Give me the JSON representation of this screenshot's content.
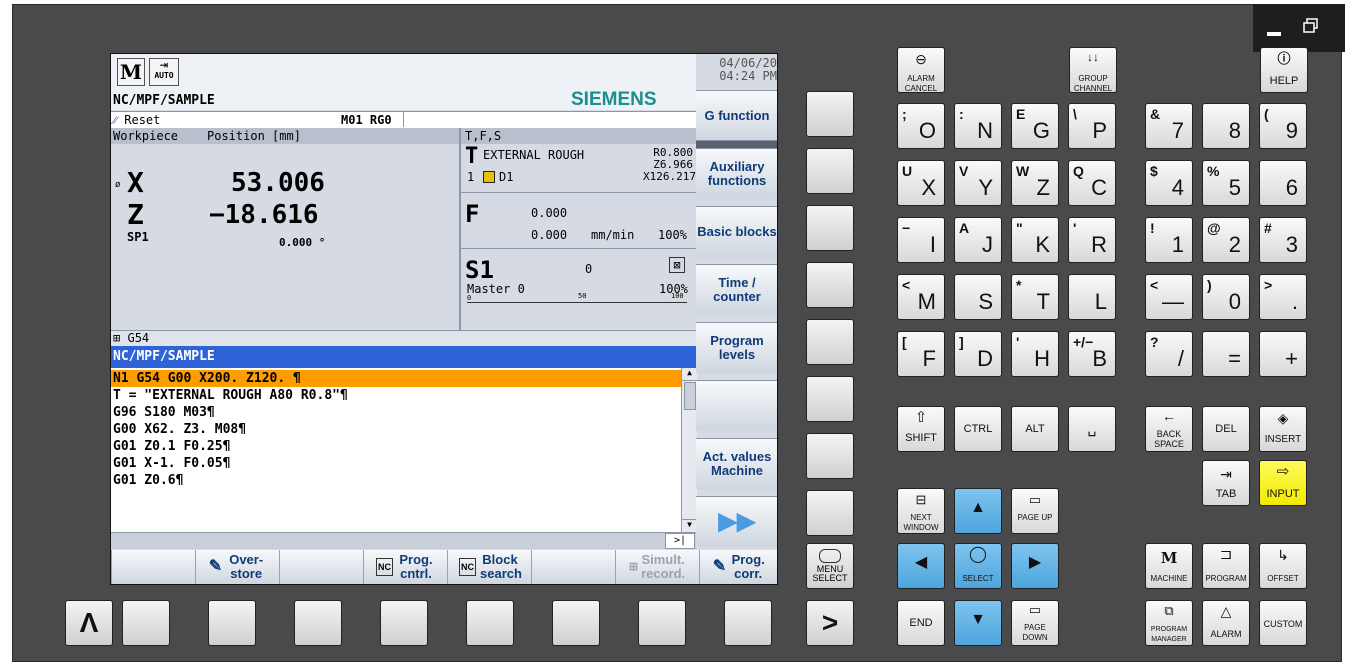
{
  "window": {
    "minimize_icon": "minimize-icon",
    "restore_icon": "restore-icon"
  },
  "screen": {
    "mode_icon_label": "M",
    "auto_label": "AUTO",
    "date": "04/06/20",
    "time": "04:24 PM",
    "program_path": "NC/MPF/SAMPLE",
    "brand": "SIEMENS",
    "status": "Reset",
    "status_right": "M01 RG0",
    "wcs_label": "Workpiece",
    "position_label": "Position [mm]",
    "tfs_label": "T,F,S",
    "axes": [
      {
        "name": "X",
        "prefix": "ø",
        "value": "53.006"
      },
      {
        "name": "Z",
        "prefix": "",
        "value": "−18.616"
      }
    ],
    "spindle": {
      "name": "SP1",
      "value": "0.000",
      "unit": "°"
    },
    "tool": {
      "letter": "T",
      "name": "EXTERNAL ROUGH",
      "radius": "R0.800",
      "z": "Z6.966",
      "x": "X126.217",
      "num": "1",
      "d": "D1"
    },
    "feed": {
      "letter": "F",
      "v1": "0.000",
      "v2": "0.000",
      "unit": "mm/min",
      "pct": "100%"
    },
    "s1": {
      "label": "S1",
      "value": "0",
      "master": "Master",
      "master_val": "0",
      "pct": "100%",
      "scale_0": "0",
      "scale_50": "50",
      "scale_100": "100"
    },
    "frame": "G54",
    "editor_path": "NC/MPF/SAMPLE",
    "code_lines": [
      "N1 G54 G00 X200. Z120. ¶",
      "T = \"EXTERNAL ROUGH A80 R0.8\"¶",
      "G96 S180 M03¶",
      "G00 X62. Z3. M08¶",
      "G01 Z0.1 F0.25¶",
      "G01 X-1. F0.05¶",
      "G01 Z0.6¶"
    ],
    "vsoftkeys": [
      "G function",
      "Auxiliary functions",
      "Basic blocks",
      "Time / counter",
      "Program levels",
      "",
      "Act. values Machine",
      ""
    ],
    "hsoftkeys": [
      {
        "label": ""
      },
      {
        "label": "Over- store"
      },
      {
        "label": ""
      },
      {
        "label": "Prog. cntrl."
      },
      {
        "label": "Block search"
      },
      {
        "label": ""
      },
      {
        "label": "Simult. record."
      },
      {
        "label": "Prog. corr."
      }
    ]
  },
  "keys": {
    "alarm_cancel": "ALARM CANCEL",
    "group_channel": "GROUP CHANNEL",
    "help": "HELP",
    "menu_select": "MENU SELECT",
    "shift": "SHIFT",
    "ctrl": "CTRL",
    "alt": "ALT",
    "backspace": "BACK SPACE",
    "del": "DEL",
    "insert": "INSERT",
    "tab": "TAB",
    "input": "INPUT",
    "next_window": "NEXT WINDOW",
    "page_up": "PAGE UP",
    "page_down": "PAGE DOWN",
    "select": "SELECT",
    "end": "END",
    "machine": "MACHINE",
    "program": "PROGRAM",
    "offset": "OFFSET",
    "program_manager": "PROGRAM MANAGER",
    "alarm": "ALARM",
    "custom": "CUSTOM",
    "alpha": [
      {
        "main": "O",
        "sub": ";"
      },
      {
        "main": "N",
        "sub": ":"
      },
      {
        "main": "G",
        "sub": "E"
      },
      {
        "main": "P",
        "sub": "\\"
      },
      {
        "main": "X",
        "sub": "U"
      },
      {
        "main": "Y",
        "sub": "V"
      },
      {
        "main": "Z",
        "sub": "W"
      },
      {
        "main": "C",
        "sub": "Q"
      },
      {
        "main": "I",
        "sub": "−"
      },
      {
        "main": "J",
        "sub": "A"
      },
      {
        "main": "K",
        "sub": "\""
      },
      {
        "main": "R",
        "sub": "'"
      },
      {
        "main": "M",
        "sub": "<"
      },
      {
        "main": "S",
        "sub": ""
      },
      {
        "main": "T",
        "sub": "*"
      },
      {
        "main": "L",
        "sub": ""
      },
      {
        "main": "F",
        "sub": "["
      },
      {
        "main": "D",
        "sub": "]"
      },
      {
        "main": "H",
        "sub": "'"
      },
      {
        "main": "B",
        "sub": "+/−"
      }
    ],
    "num": [
      {
        "main": "7",
        "sub": "&"
      },
      {
        "main": "8",
        "sub": ""
      },
      {
        "main": "9",
        "sub": "("
      },
      {
        "main": "4",
        "sub": "$"
      },
      {
        "main": "5",
        "sub": "%"
      },
      {
        "main": "6",
        "sub": ""
      },
      {
        "main": "1",
        "sub": "!"
      },
      {
        "main": "2",
        "sub": "@"
      },
      {
        "main": "3",
        "sub": "#"
      },
      {
        "main": "—",
        "sub": "<"
      },
      {
        "main": "0",
        "sub": ")"
      },
      {
        "main": ".",
        "sub": ">"
      },
      {
        "main": "/",
        "sub": "?"
      },
      {
        "main": "=",
        "sub": ""
      },
      {
        "main": "+",
        "sub": ""
      }
    ],
    "bottom_left": "Λ",
    "bottom_right": ">"
  },
  "colors": {
    "highlight": "#ff9c00",
    "editor_header": "#2f64d8",
    "input_key": "#f5ee00",
    "arrow_key": "#56abe0",
    "brand": "#1a8f8f"
  }
}
